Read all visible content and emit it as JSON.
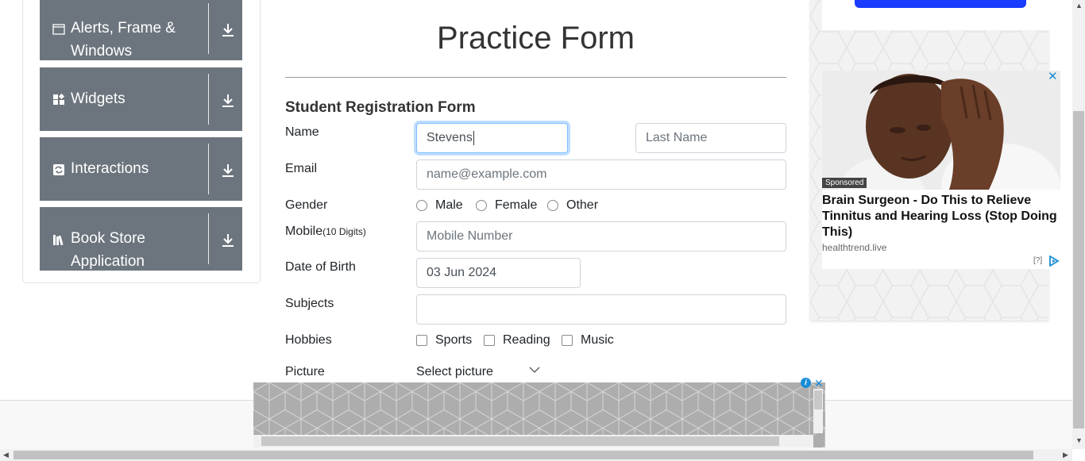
{
  "sidebar": {
    "items": [
      {
        "label_line1": "Alerts, Frame &",
        "label_line2": "Windows",
        "icon": "window-icon"
      },
      {
        "label_line1": "Widgets",
        "label_line2": "",
        "icon": "widgets-icon"
      },
      {
        "label_line1": "Interactions",
        "label_line2": "",
        "icon": "interactions-icon"
      },
      {
        "label_line1": "Book Store",
        "label_line2": "Application",
        "icon": "books-icon"
      }
    ]
  },
  "form": {
    "title": "Practice Form",
    "subtitle": "Student Registration Form",
    "name_label": "Name",
    "first_name_value": "Stevens",
    "last_name_placeholder": "Last Name",
    "email_label": "Email",
    "email_placeholder": "name@example.com",
    "gender_label": "Gender",
    "gender_options": [
      "Male",
      "Female",
      "Other"
    ],
    "mobile_label": "Mobile",
    "mobile_hint": "(10 Digits)",
    "mobile_placeholder": "Mobile Number",
    "dob_label": "Date of Birth",
    "dob_value": "03 Jun 2024",
    "subjects_label": "Subjects",
    "subjects_value": "",
    "hobbies_label": "Hobbies",
    "hobbies_options": [
      "Sports",
      "Reading",
      "Music"
    ],
    "picture_label": "Picture",
    "picture_button": "Select picture"
  },
  "ad": {
    "sponsored": "Sponsored",
    "headline": "Brain Surgeon - Do This to Relieve Tinnitus and Hearing Loss (Stop Doing This)",
    "domain": "healthtrend.live",
    "info": "[?]"
  },
  "colors": {
    "sidebar_bg": "#6c757d",
    "focus_border": "#80bdff",
    "ad_accent": "#1a8dd6"
  }
}
